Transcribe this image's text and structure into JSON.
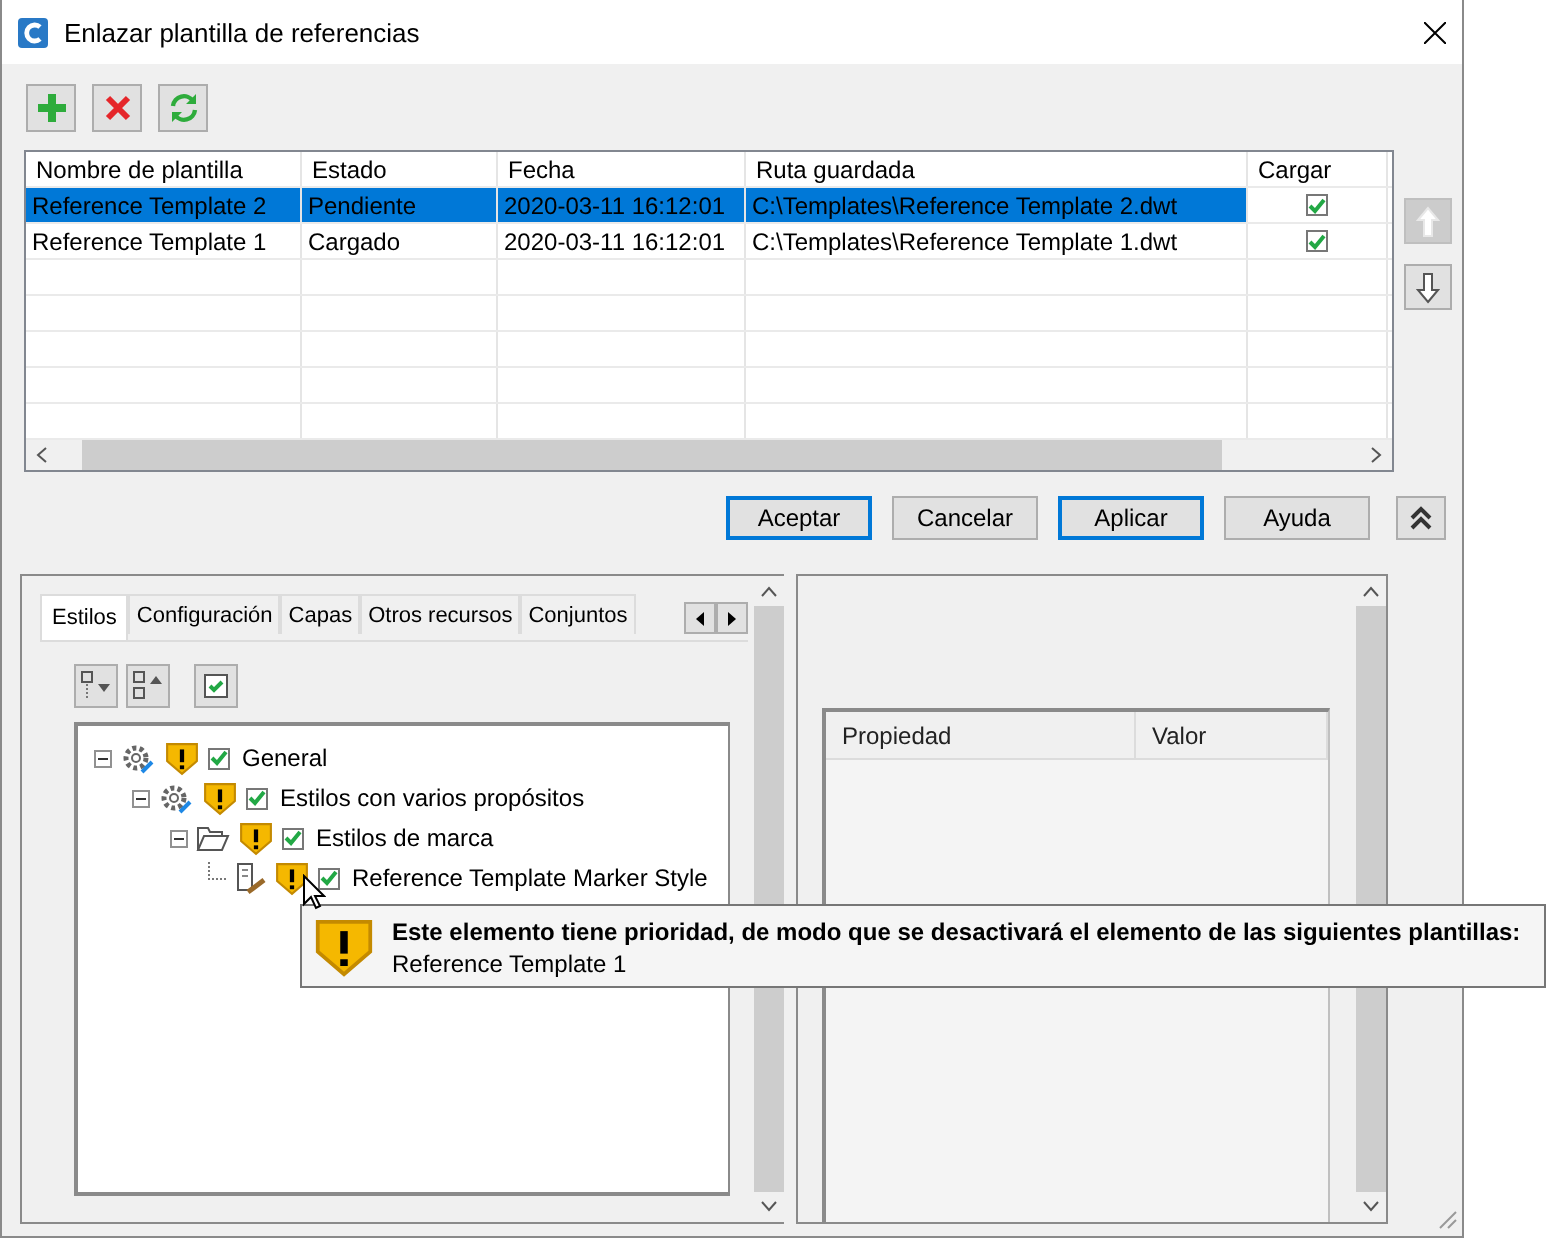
{
  "window": {
    "title": "Enlazar plantilla de referencias"
  },
  "toolbar": [
    {
      "kind": "add"
    },
    {
      "kind": "remove"
    },
    {
      "kind": "refresh"
    }
  ],
  "table": {
    "columns": [
      "Nombre de plantilla",
      "Estado",
      "Fecha",
      "Ruta guardada",
      "Cargar"
    ],
    "rows": [
      {
        "cells": [
          "Reference Template 2",
          "Pendiente",
          "2020-03-11 16:12:01",
          "C:\\Templates\\Reference Template 2.dwt"
        ],
        "load": true,
        "selected": true
      },
      {
        "cells": [
          "Reference Template 1",
          "Cargado",
          "2020-03-11 16:12:01",
          "C:\\Templates\\Reference Template 1.dwt"
        ],
        "load": true,
        "selected": false
      }
    ]
  },
  "move_buttons": [
    {
      "kind": "up",
      "disabled": true
    },
    {
      "kind": "down",
      "disabled": false
    }
  ],
  "buttons": [
    {
      "label": "Aceptar",
      "focused": true
    },
    {
      "label": "Cancelar",
      "focused": false
    },
    {
      "label": "Aplicar",
      "focused": true
    },
    {
      "label": "Ayuda",
      "focused": false
    }
  ],
  "tabs": [
    {
      "label": "Estilos",
      "selected": true
    },
    {
      "label": "Configuración",
      "selected": false
    },
    {
      "label": "Capas",
      "selected": false
    },
    {
      "label": "Otros recursos",
      "selected": false
    },
    {
      "label": "Conjuntos",
      "selected": false
    }
  ],
  "tree": [
    {
      "label": "General",
      "kind": "gear",
      "warning": true,
      "checked": true,
      "expanded": true,
      "children": [
        {
          "label": "Estilos con varios propósitos",
          "kind": "gear",
          "warning": true,
          "checked": true,
          "expanded": true,
          "children": [
            {
              "label": "Estilos de marca",
              "kind": "folder",
              "warning": true,
              "checked": true,
              "expanded": true,
              "children": [
                {
                  "label": "Reference Template Marker Style",
                  "kind": "style",
                  "warning": true,
                  "checked": true
                }
              ]
            }
          ]
        }
      ]
    }
  ],
  "properties": {
    "columns": [
      "Propiedad",
      "Valor"
    ]
  },
  "tooltip": {
    "title": "Este elemento tiene prioridad, de modo que se desactivará el elemento de las siguientes plantillas:",
    "text": "Reference Template 1"
  }
}
